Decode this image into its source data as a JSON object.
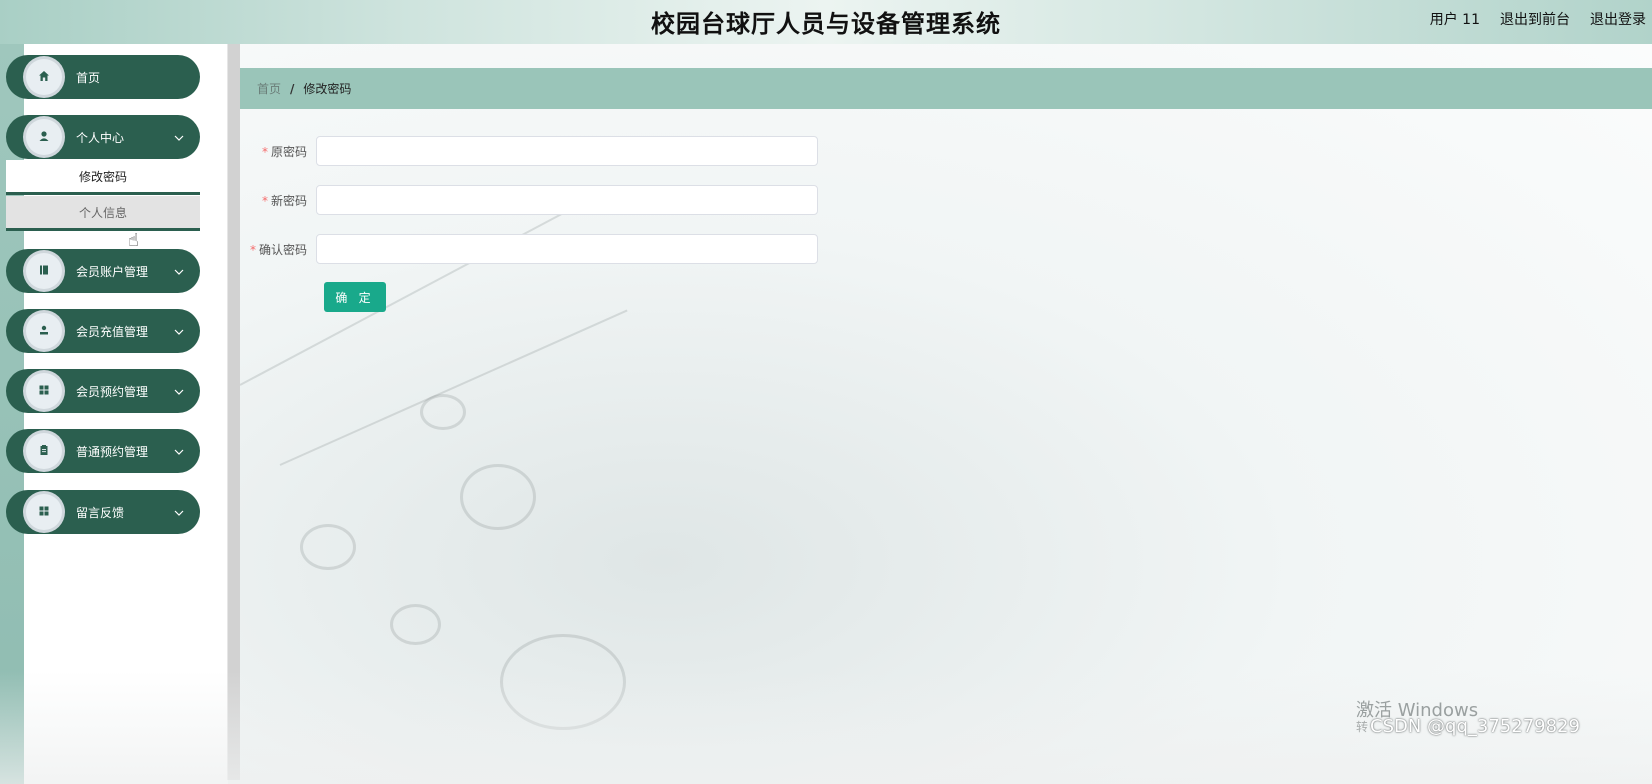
{
  "header": {
    "title": "校园台球厅人员与设备管理系统",
    "user_label": "用户 11",
    "to_front_label": "退出到前台",
    "logout_label": "退出登录"
  },
  "sidebar": {
    "items": [
      {
        "label": "首页",
        "icon": "home-icon"
      },
      {
        "label": "个人中心",
        "icon": "user-icon",
        "expanded": true,
        "children": [
          {
            "label": "修改密码",
            "active": true
          },
          {
            "label": "个人信息",
            "hovered": true
          }
        ]
      },
      {
        "label": "会员账户管理",
        "icon": "book-icon"
      },
      {
        "label": "会员充值管理",
        "icon": "user-stamp-icon"
      },
      {
        "label": "会员预约管理",
        "icon": "grid-icon"
      },
      {
        "label": "普通预约管理",
        "icon": "clipboard-icon"
      },
      {
        "label": "留言反馈",
        "icon": "grid-icon"
      }
    ]
  },
  "breadcrumb": {
    "home": "首页",
    "separator": "/",
    "current": "修改密码"
  },
  "form": {
    "required_mark": "*",
    "fields": [
      {
        "label": "原密码",
        "value": ""
      },
      {
        "label": "新密码",
        "value": ""
      },
      {
        "label": "确认密码",
        "value": ""
      }
    ],
    "submit_label": "确 定"
  },
  "watermark": {
    "activate_windows": "激活 Windows",
    "activate_sub": "转",
    "csdn": "CSDN @qq_375279829"
  },
  "colors": {
    "sidebar_item_bg": "#2b5f4f",
    "breadcrumb_bg": "#9ac5b9",
    "primary_button": "#19a98b",
    "required": "#f56c6c"
  }
}
